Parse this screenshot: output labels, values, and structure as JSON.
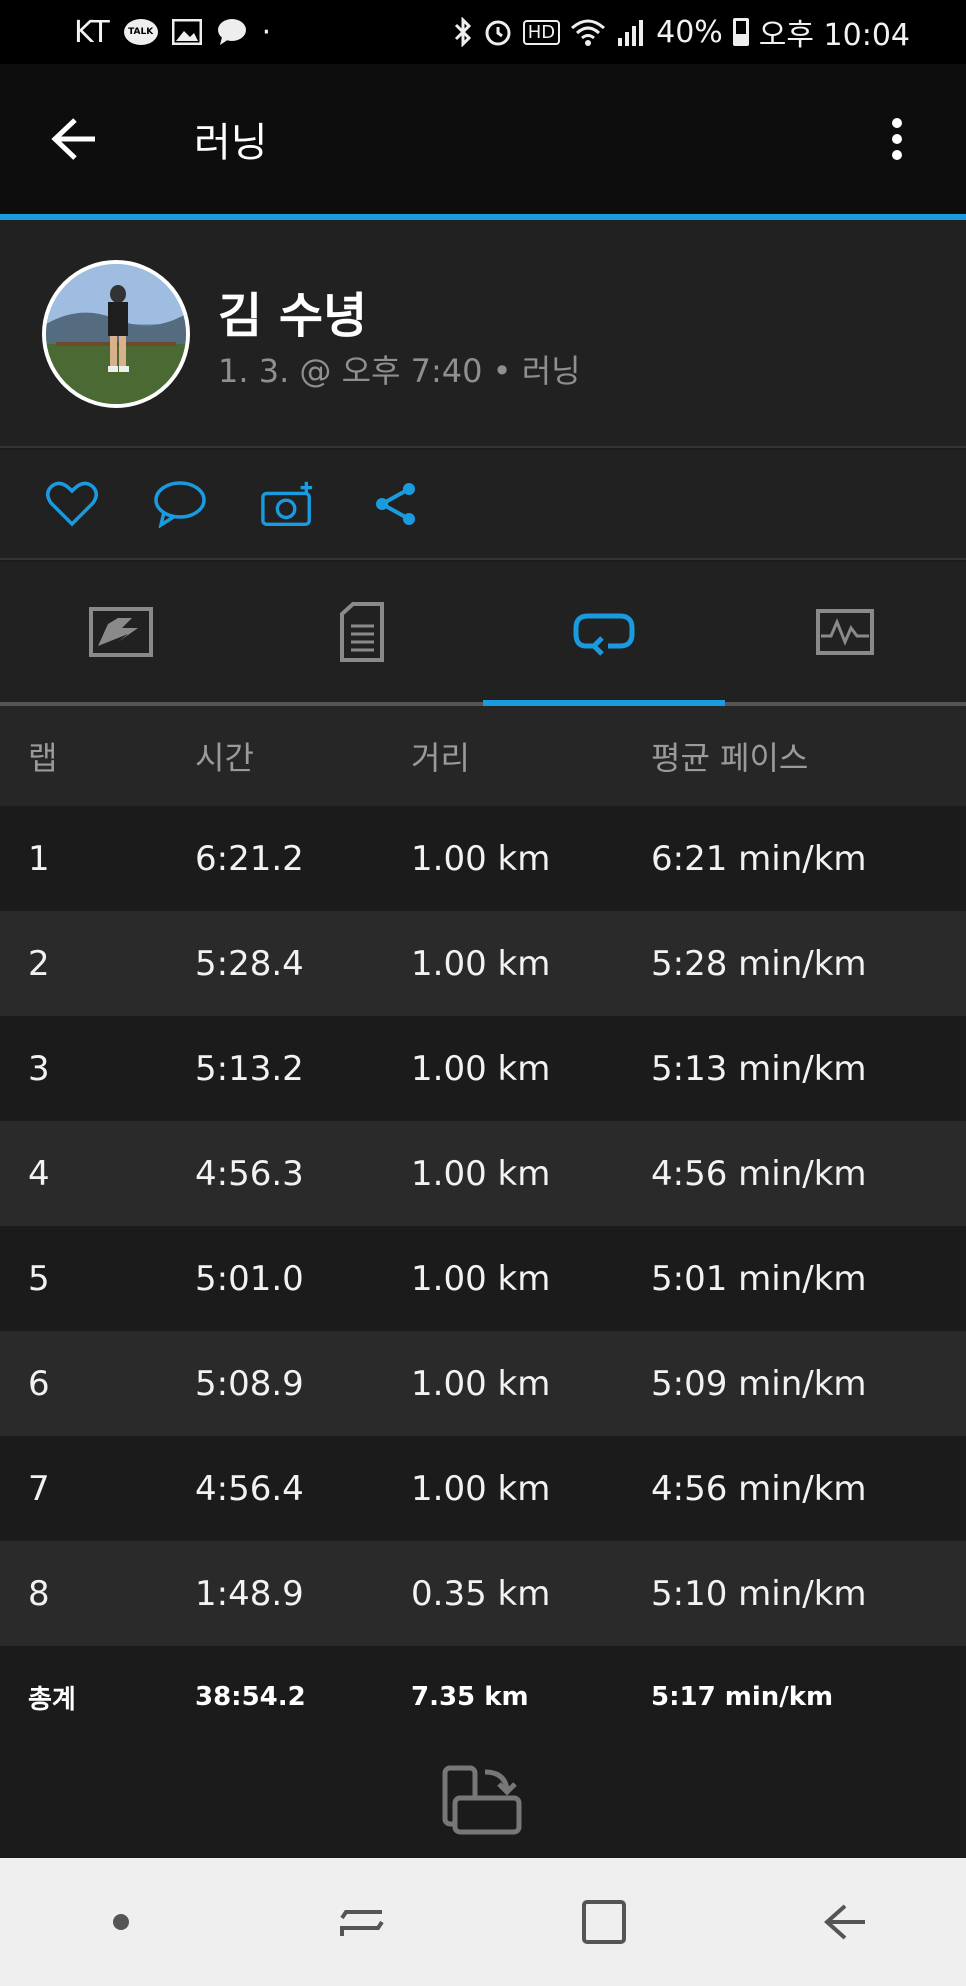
{
  "status_bar": {
    "carrier": "KT",
    "talk_badge": "TALK",
    "dot": "·",
    "hd_badge": "HD",
    "battery_percent": "40%",
    "time": "오후 10:04"
  },
  "app_bar": {
    "title": "러닝"
  },
  "profile": {
    "name": "김 수녕",
    "meta": "1. 3. @ 오후 7:40 • 러닝"
  },
  "actions": [
    "heart-icon",
    "comment-icon",
    "camera-add-icon",
    "share-icon"
  ],
  "tabs": [
    {
      "icon": "chart-map-icon",
      "active": false
    },
    {
      "icon": "document-list-icon",
      "active": false
    },
    {
      "icon": "laps-icon",
      "active": true
    },
    {
      "icon": "stats-graph-icon",
      "active": false
    }
  ],
  "accent_color": "#1a9be0",
  "table": {
    "headers": [
      "랩",
      "시간",
      "거리",
      "평균 페이스"
    ],
    "rows": [
      [
        "1",
        "6:21.2",
        "1.00 km",
        "6:21 min/km"
      ],
      [
        "2",
        "5:28.4",
        "1.00 km",
        "5:28 min/km"
      ],
      [
        "3",
        "5:13.2",
        "1.00 km",
        "5:13 min/km"
      ],
      [
        "4",
        "4:56.3",
        "1.00 km",
        "4:56 min/km"
      ],
      [
        "5",
        "5:01.0",
        "1.00 km",
        "5:01 min/km"
      ],
      [
        "6",
        "5:08.9",
        "1.00 km",
        "5:09 min/km"
      ],
      [
        "7",
        "4:56.4",
        "1.00 km",
        "4:56 min/km"
      ],
      [
        "8",
        "1:48.9",
        "0.35 km",
        "5:10 min/km"
      ]
    ],
    "total": [
      "총계",
      "38:54.2",
      "7.35 km",
      "5:17 min/km"
    ]
  }
}
